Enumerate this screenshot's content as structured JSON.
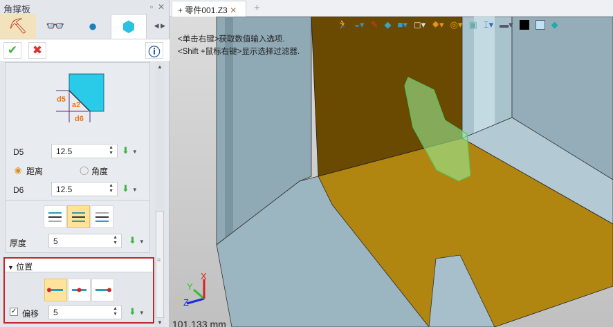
{
  "panel": {
    "title": "角撑板",
    "pin_icon": "pin-icon",
    "close_icon": "close-icon",
    "tabs": [
      {
        "icon": "stamp-icon"
      },
      {
        "icon": "glasses-icon"
      },
      {
        "icon": "sphere-icon"
      },
      {
        "icon": "gusset-icon",
        "active": true
      }
    ],
    "diagram": {
      "d5": "d5",
      "a2": "a2",
      "d6": "d6"
    },
    "d5": {
      "label": "D5",
      "value": "12.5"
    },
    "radio": {
      "distance": "距离",
      "angle": "角度",
      "selected": "distance"
    },
    "d6": {
      "label": "D6",
      "value": "12.5"
    },
    "thickness": {
      "label": "厚度",
      "value": "5"
    },
    "position": {
      "title": "位置"
    },
    "offset": {
      "label": "偏移",
      "value": "5",
      "checked": true
    }
  },
  "document": {
    "tab": "零件001.Z3",
    "add_tab": "+",
    "hint1": "<单击右键>获取数值输入选项.",
    "hint2": "<Shift +鼠标右键>显示选择过滤器.",
    "measure": "101.133 mm",
    "axes": {
      "x": "X",
      "y": "Y",
      "z": "Z"
    }
  },
  "colors": {
    "accent": "#d9a400",
    "highlight": "#fde49a",
    "frame": "#c0272d",
    "floor": "#b08510",
    "wall": "#8fa9b5"
  }
}
